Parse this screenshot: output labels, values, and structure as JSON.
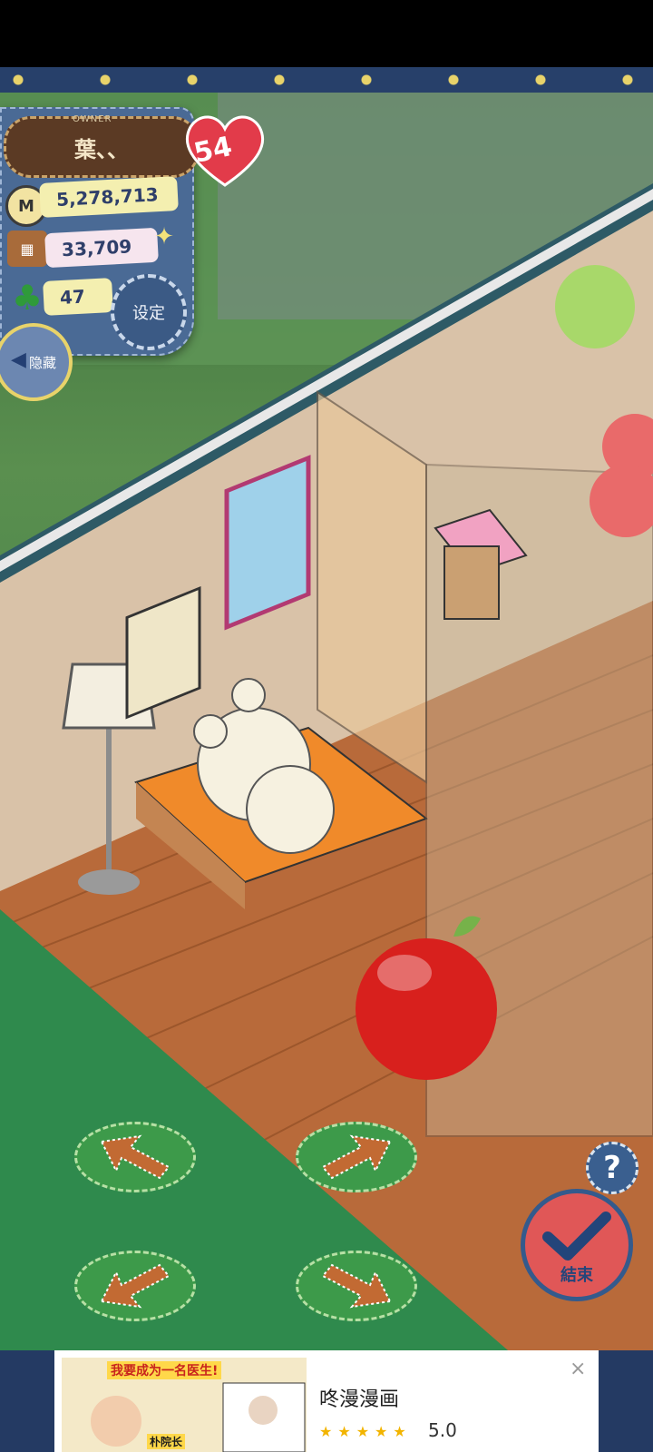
{
  "hud": {
    "owner_label": "OWNER",
    "player_name": "葉、、",
    "hearts": "54",
    "money": "5,278,713",
    "items": "33,709",
    "clovers": "47",
    "settings_label": "设定",
    "hide_label": "隐藏"
  },
  "controls": {
    "finish_label": "結束",
    "help_label": "?"
  },
  "ad": {
    "banner_text": "我要成为一名医生!",
    "tag_text": "朴院长",
    "title": "咚漫漫画",
    "stars": "★★★★★",
    "rating": "5.0",
    "close": "×"
  },
  "colors": {
    "accent_red": "#e05757",
    "panel_blue": "#4a6a95",
    "pill_yellow": "#f4efb0",
    "arrow_green": "#3d9a4a"
  }
}
